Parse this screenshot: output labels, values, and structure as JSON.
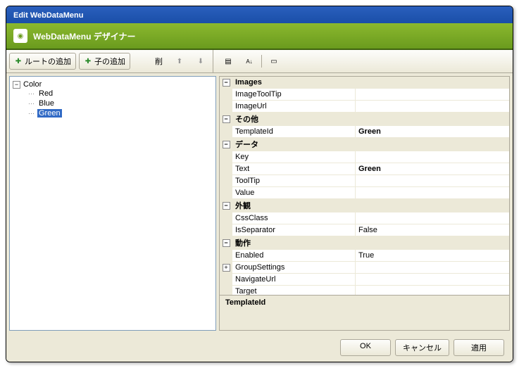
{
  "title": "Edit WebDataMenu",
  "subheader": {
    "title": "WebDataMenu デザイナー"
  },
  "leftToolbar": {
    "addRoot": "ルートの追加",
    "addChild": "子の追加",
    "delete": "削"
  },
  "tree": {
    "root": "Color",
    "children": [
      "Red",
      "Blue",
      "Green"
    ],
    "selected": "Green"
  },
  "propCategories": [
    {
      "name": "Images",
      "expanded": true,
      "rows": [
        {
          "name": "ImageToolTip",
          "value": ""
        },
        {
          "name": "ImageUrl",
          "value": ""
        }
      ]
    },
    {
      "name": "その他",
      "expanded": true,
      "rows": [
        {
          "name": "TemplateId",
          "value": "Green",
          "bold": true
        }
      ]
    },
    {
      "name": "データ",
      "expanded": true,
      "rows": [
        {
          "name": "Key",
          "value": ""
        },
        {
          "name": "Text",
          "value": "Green",
          "bold": true
        },
        {
          "name": "ToolTip",
          "value": ""
        },
        {
          "name": "Value",
          "value": ""
        }
      ]
    },
    {
      "name": "外観",
      "expanded": true,
      "rows": [
        {
          "name": "CssClass",
          "value": ""
        },
        {
          "name": "IsSeparator",
          "value": "False"
        }
      ]
    },
    {
      "name": "動作",
      "expanded": true,
      "rows": [
        {
          "name": "Enabled",
          "value": "True"
        },
        {
          "name": "GroupSettings",
          "value": "",
          "expandable": true
        },
        {
          "name": "NavigateUrl",
          "value": ""
        },
        {
          "name": "Target",
          "value": ""
        }
      ]
    }
  ],
  "description": {
    "title": "TemplateId",
    "text": ""
  },
  "buttons": {
    "ok": "OK",
    "cancel": "キャンセル",
    "apply": "適用"
  }
}
